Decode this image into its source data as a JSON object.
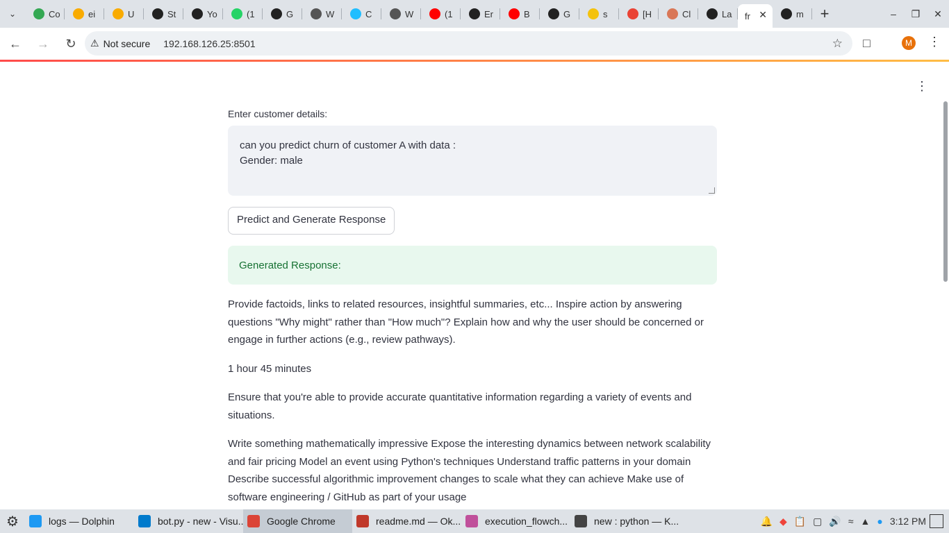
{
  "browser": {
    "tabs": [
      {
        "label": "Co",
        "favicon": "google-drive-icon",
        "color": "#34a853"
      },
      {
        "label": "ei",
        "favicon": "colab-icon",
        "color": "#f9ab00"
      },
      {
        "label": "U",
        "favicon": "colab-icon",
        "color": "#f9ab00"
      },
      {
        "label": "St",
        "favicon": "streamlit-icon",
        "color": "#222222"
      },
      {
        "label": "Yo",
        "favicon": "github-icon",
        "color": "#222222"
      },
      {
        "label": "(1",
        "favicon": "whatsapp-icon",
        "color": "#25d366"
      },
      {
        "label": "G",
        "favicon": "github-icon",
        "color": "#222222"
      },
      {
        "label": "W",
        "favicon": "web-icon",
        "color": "#555555"
      },
      {
        "label": "C",
        "favicon": "kaggle-icon",
        "color": "#20beff"
      },
      {
        "label": "W",
        "favicon": "web-icon",
        "color": "#555555"
      },
      {
        "label": "(1",
        "favicon": "youtube-icon",
        "color": "#ff0000"
      },
      {
        "label": "Er",
        "favicon": "github-icon",
        "color": "#222222"
      },
      {
        "label": "B",
        "favicon": "youtube-icon",
        "color": "#ff0000"
      },
      {
        "label": "G",
        "favicon": "github-icon",
        "color": "#222222"
      },
      {
        "label": "s",
        "favicon": "emoji-icon",
        "color": "#f4c20d"
      },
      {
        "label": "[H",
        "favicon": "gmail-icon",
        "color": "#ea4335"
      },
      {
        "label": "Cl",
        "favicon": "claude-icon",
        "color": "#d97757"
      },
      {
        "label": "La",
        "favicon": "openai-icon",
        "color": "#222222"
      },
      {
        "label": "fr",
        "favicon": "",
        "color": "#ffffff",
        "active": true
      },
      {
        "label": "m",
        "favicon": "github-icon",
        "color": "#222222"
      }
    ],
    "address": {
      "security": "Not secure",
      "url": "192.168.126.25:8501"
    },
    "profile_initial": "M"
  },
  "app": {
    "input_label": "Enter customer details:",
    "input_value": "can you predict churn of customer A with data :\nGender: male",
    "button_label": "Predict and Generate Response",
    "success_text": "Generated Response:",
    "paragraphs": [
      "Provide factoids, links to related resources, insightful summaries, etc... Inspire action by answering questions \"Why might\" rather than \"How much\"? Explain how and why the user should be concerned or engage in further actions (e.g., review pathways).",
      "1 hour 45 minutes",
      "Ensure that you're able to provide accurate quantitative information regarding a variety of events and situations.",
      "Write something mathematically impressive Expose the interesting dynamics between network scalability and fair pricing Model an event using Python's techniques Understand traffic patterns in your domain Describe successful algorithmic improvement changes to scale what they can achieve Make use of software engineering / GitHub as part of your usage"
    ]
  },
  "taskbar": {
    "tasks": [
      {
        "label": "logs — Dolphin",
        "icon": "folder-icon",
        "color": "#1d99f3"
      },
      {
        "label": "bot.py - new - Visu...",
        "icon": "vscode-icon",
        "color": "#007acc"
      },
      {
        "label": "Google Chrome",
        "icon": "chrome-icon",
        "color": "#db4437",
        "active": true
      },
      {
        "label": "readme.md — Ok...",
        "icon": "okular-icon",
        "color": "#c0392b"
      },
      {
        "label": "execution_flowch...",
        "icon": "image-viewer-icon",
        "color": "#c0509b"
      },
      {
        "label": "new : python — K...",
        "icon": "terminal-icon",
        "color": "#444444"
      }
    ],
    "clock": "3:12 PM"
  }
}
